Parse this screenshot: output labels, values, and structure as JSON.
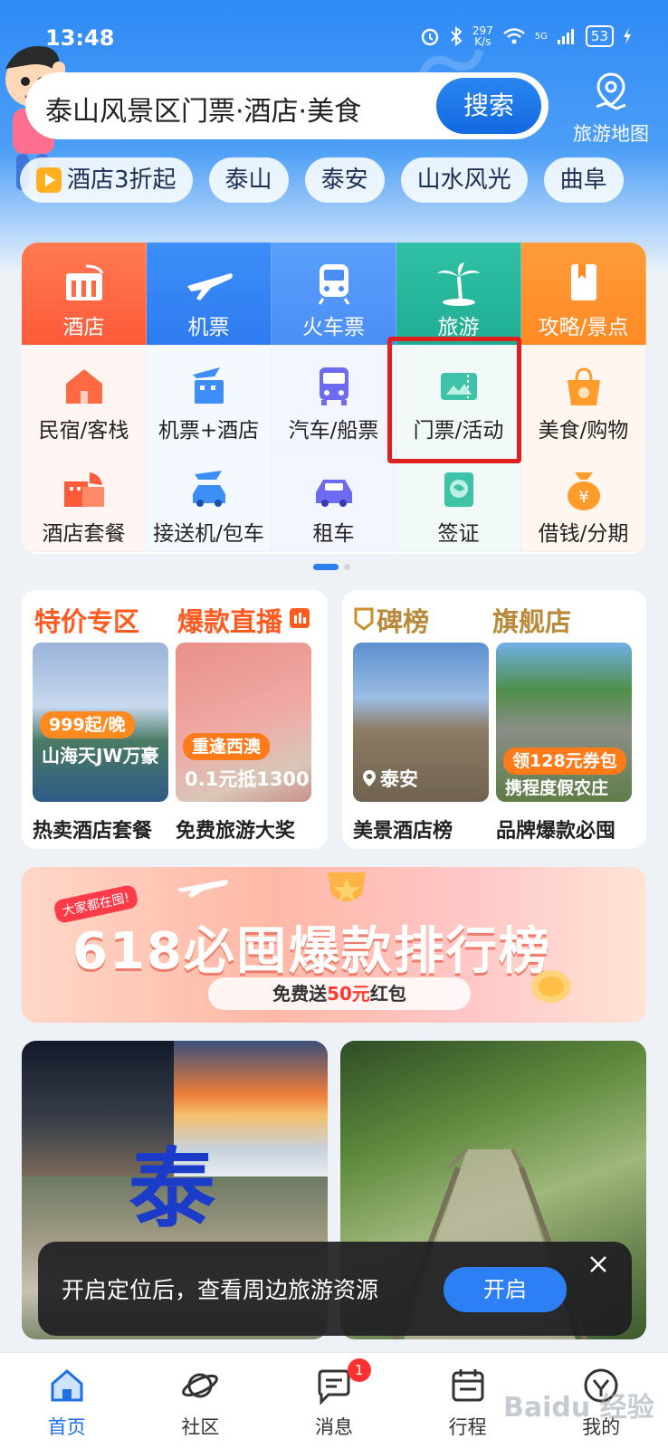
{
  "colors": {
    "accent": "#2b7ff0",
    "highlight_box": "#e0201f",
    "badge": "#ff3030"
  },
  "status": {
    "time": "13:48",
    "net_speed_value": "297",
    "net_speed_unit": "K/s",
    "signal": "5G",
    "battery": "53"
  },
  "search": {
    "text": "泰山风景区门票·酒店·美食",
    "button": "搜索"
  },
  "map_button": {
    "label": "旅游地图",
    "icon": "location-map-icon"
  },
  "chips": [
    "酒店3折起",
    "泰山",
    "泰安",
    "山水风光",
    "曲阜"
  ],
  "grid": {
    "row1": [
      {
        "label": "酒店",
        "icon": "hotel-building-icon"
      },
      {
        "label": "机票",
        "icon": "airplane-icon"
      },
      {
        "label": "火车票",
        "icon": "train-icon"
      },
      {
        "label": "旅游",
        "icon": "palm-tree-icon"
      },
      {
        "label": "攻略/景点",
        "icon": "book-icon"
      }
    ],
    "row2": [
      {
        "label": "民宿/客栈",
        "icon": "house-icon"
      },
      {
        "label": "机票+酒店",
        "icon": "flight-hotel-icon"
      },
      {
        "label": "汽车/船票",
        "icon": "bus-icon"
      },
      {
        "label": "门票/活动",
        "icon": "ticket-icon"
      },
      {
        "label": "美食/购物",
        "icon": "shopping-bag-icon"
      }
    ],
    "row3": [
      {
        "label": "酒店套餐",
        "icon": "hotel-package-icon"
      },
      {
        "label": "接送机/包车",
        "icon": "car-transfer-icon"
      },
      {
        "label": "租车",
        "icon": "car-icon"
      },
      {
        "label": "签证",
        "icon": "globe-icon"
      },
      {
        "label": "借钱/分期",
        "icon": "money-bag-icon"
      }
    ]
  },
  "promo_left": {
    "title1": "特价专区",
    "title2": "爆款直播",
    "card1": {
      "tag": "999起/晚",
      "overlay": "山海天JW万豪",
      "caption": "热卖酒店套餐"
    },
    "card2": {
      "tag": "重逢西澳",
      "overlay": "0.1元抵1300",
      "caption": "免费旅游大奖"
    }
  },
  "promo_right": {
    "title1": "碑榜",
    "title2": "旗舰店",
    "card1": {
      "location": "泰安",
      "caption": "美景酒店榜"
    },
    "card2": {
      "tag": "领128元券包",
      "overlay": "携程度假农庄",
      "caption": "品牌爆款必囤"
    }
  },
  "banner": {
    "badge": "大家都在囤!",
    "title": "618必囤爆款排行榜",
    "sub_prefix": "免费送",
    "sub_amount": "50元",
    "sub_suffix": "红包"
  },
  "feed": {
    "left_char": "泰"
  },
  "toast": {
    "text": "开启定位后，查看周边旅游资源",
    "button": "开启"
  },
  "tabs": [
    {
      "label": "首页",
      "icon": "home-icon",
      "active": true
    },
    {
      "label": "社区",
      "icon": "planet-icon"
    },
    {
      "label": "消息",
      "icon": "message-icon",
      "badge": "1"
    },
    {
      "label": "行程",
      "icon": "calendar-icon"
    },
    {
      "label": "我的",
      "icon": "profile-icon"
    }
  ],
  "watermark": "Baidu 经验"
}
